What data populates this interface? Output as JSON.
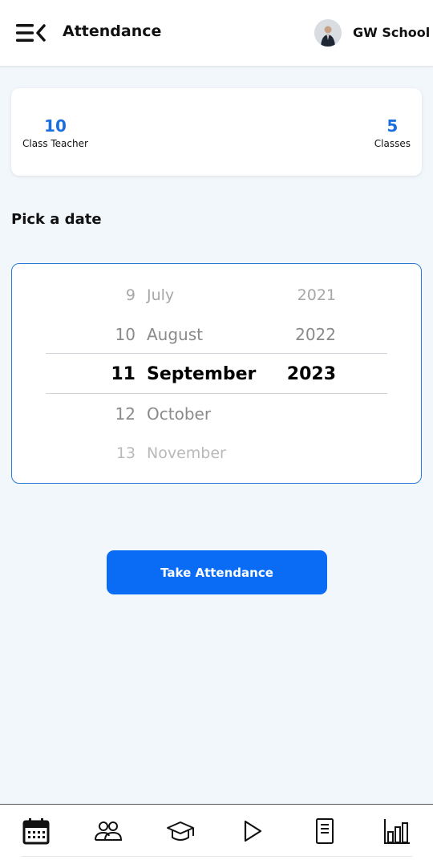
{
  "header": {
    "title": "Attendance",
    "school_name": "GW School",
    "menu_icon": "menu-collapse-icon",
    "avatar_icon": "person-avatar"
  },
  "stats": {
    "class_teacher_value": "10",
    "class_teacher_label": "Class Teacher",
    "classes_value": "5",
    "classes_label": "Classes",
    "accent_color": "#1a6fdc"
  },
  "picker": {
    "label": "Pick a date",
    "rows": [
      {
        "day": "9",
        "month": "July",
        "year": "2021"
      },
      {
        "day": "10",
        "month": "August",
        "year": "2022"
      },
      {
        "day": "11",
        "month": "September",
        "year": "2023"
      },
      {
        "day": "12",
        "month": "October",
        "year": ""
      },
      {
        "day": "13",
        "month": "November",
        "year": ""
      }
    ],
    "selected": {
      "day": "11",
      "month": "September",
      "year": "2023"
    },
    "border_color": "#2a7bd5"
  },
  "actions": {
    "take_attendance": "Take Attendance",
    "button_color": "#0a6cf5"
  },
  "bottom_nav": {
    "items": [
      {
        "icon": "calendar-icon"
      },
      {
        "icon": "people-icon"
      },
      {
        "icon": "graduation-cap-icon"
      },
      {
        "icon": "play-icon"
      },
      {
        "icon": "document-icon"
      },
      {
        "icon": "bar-chart-icon"
      }
    ]
  }
}
